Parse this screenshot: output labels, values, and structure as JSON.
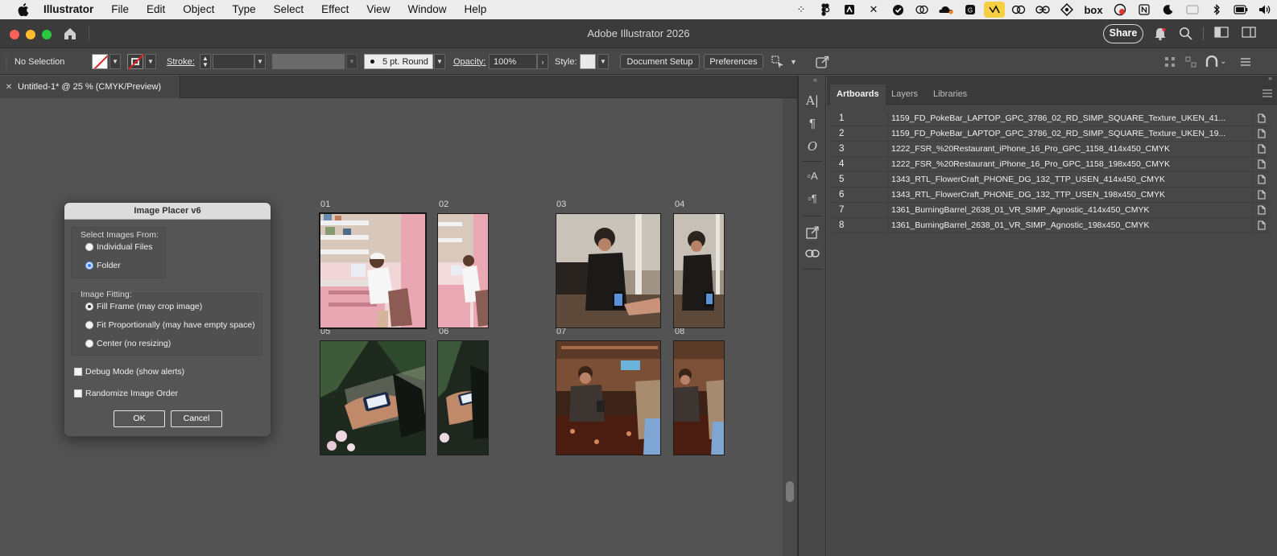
{
  "menubar": {
    "app": "Illustrator",
    "items": [
      "File",
      "Edit",
      "Object",
      "Type",
      "Select",
      "Effect",
      "View",
      "Window",
      "Help"
    ],
    "status_icons": [
      "dots-grid-icon",
      "figma-icon",
      "notion-icon",
      "x-icon",
      "checkmark-circle-icon",
      "overlap-circles-icon",
      "cloudflare-icon",
      "calendar-icon",
      "highlighted-app-icon",
      "link-icon",
      "linear-icon",
      "sync-icon",
      "box-icon",
      "recording-icon",
      "notion-n-icon",
      "moon-icon",
      "window-icon",
      "bluetooth-icon",
      "battery-icon",
      "volume-icon"
    ],
    "box_text": "box"
  },
  "titlebar": {
    "title": "Adobe Illustrator 2026",
    "share": "Share"
  },
  "controlbar": {
    "selection": "No Selection",
    "stroke_label": "Stroke:",
    "brush": "5 pt. Round",
    "opacity_label": "Opacity:",
    "opacity_value": "100%",
    "style_label": "Style:",
    "document_setup": "Document Setup",
    "preferences": "Preferences"
  },
  "document": {
    "tab_title": "Untitled-1* @ 25 % (CMYK/Preview)"
  },
  "canvas": {
    "artboards": [
      {
        "label": "01",
        "colors": [
          "#e9a6b3",
          "#8c5b53",
          "#f1d6d7"
        ]
      },
      {
        "label": "02",
        "colors": [
          "#eaa8b4",
          "#8a5d55",
          "#f3dbdc"
        ]
      },
      {
        "label": "03",
        "colors": [
          "#5a5047",
          "#a09386",
          "#2a2420"
        ]
      },
      {
        "label": "04",
        "colors": [
          "#5d5249",
          "#9d9184",
          "#2b2520"
        ]
      },
      {
        "label": "05",
        "colors": [
          "#1f2a1f",
          "#3f5a3a",
          "#c8c0b2"
        ]
      },
      {
        "label": "06",
        "colors": [
          "#1e281e",
          "#3d573a",
          "#c6bdb0"
        ]
      },
      {
        "label": "07",
        "colors": [
          "#3b2318",
          "#7a4f35",
          "#a78b6f"
        ]
      },
      {
        "label": "08",
        "colors": [
          "#3a2217",
          "#7b5036",
          "#a58a70"
        ]
      }
    ]
  },
  "dialog": {
    "title": "Image Placer v6",
    "select_from_label": "Select Images From:",
    "individual_files": "Individual Files",
    "folder": "Folder",
    "fitting_label": "Image Fitting:",
    "fill_frame": "Fill Frame (may crop image)",
    "fit_prop": "Fit Proportionally (may have empty space)",
    "center": "Center (no resizing)",
    "debug": "Debug Mode (show alerts)",
    "randomize": "Randomize Image Order",
    "ok": "OK",
    "cancel": "Cancel"
  },
  "panel": {
    "tabs": [
      "Artboards",
      "Layers",
      "Libraries"
    ],
    "rows": [
      {
        "num": "1",
        "name": "1159_FD_PokeBar_LAPTOP_GPC_3786_02_RD_SIMP_SQUARE_Texture_UKEN_41..."
      },
      {
        "num": "2",
        "name": "1159_FD_PokeBar_LAPTOP_GPC_3786_02_RD_SIMP_SQUARE_Texture_UKEN_19..."
      },
      {
        "num": "3",
        "name": "1222_FSR_%20Restaurant_iPhone_16_Pro_GPC_1158_414x450_CMYK"
      },
      {
        "num": "4",
        "name": "1222_FSR_%20Restaurant_iPhone_16_Pro_GPC_1158_198x450_CMYK"
      },
      {
        "num": "5",
        "name": "1343_RTL_FlowerCraft_PHONE_DG_132_TTP_USEN_414x450_CMYK"
      },
      {
        "num": "6",
        "name": "1343_RTL_FlowerCraft_PHONE_DG_132_TTP_USEN_198x450_CMYK"
      },
      {
        "num": "7",
        "name": "1361_BurningBarrel_2638_01_VR_SIMP_Agnostic_414x450_CMYK"
      },
      {
        "num": "8",
        "name": "1361_BurningBarrel_2638_01_VR_SIMP_Agnostic_198x450_CMYK"
      }
    ]
  }
}
